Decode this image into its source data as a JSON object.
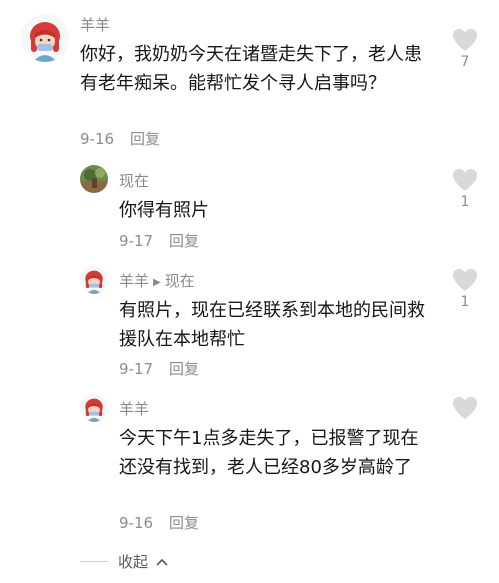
{
  "comments": [
    {
      "username": "羊羊",
      "text": "你好，我奶奶今天在诸暨走失下了，老人患有老年痴呆。能帮忙发个寻人启事吗？",
      "date": "9-16",
      "reply_label": "回复",
      "likes": "7",
      "avatar_icon": "girl-avatar-icon"
    }
  ],
  "replies": [
    {
      "username": "现在",
      "text": "你得有照片",
      "date": "9-17",
      "reply_label": "回复",
      "likes": "1",
      "avatar_icon": "photo-avatar-icon"
    },
    {
      "username": "羊羊",
      "reply_to": "现在",
      "text": "有照片，现在已经联系到本地的民间救援队在本地帮忙",
      "date": "9-17",
      "reply_label": "回复",
      "likes": "1",
      "avatar_icon": "girl-avatar-icon"
    },
    {
      "username": "羊羊",
      "text": "今天下午1点多走失了，已报警了现在还没有找到，老人已经80多岁高龄了",
      "date": "9-16",
      "reply_label": "回复",
      "likes": "",
      "avatar_icon": "girl-avatar-icon"
    }
  ],
  "collapse": {
    "label": "收起",
    "icon": "chevron-up-icon"
  },
  "colors": {
    "text": "#161616",
    "meta": "#8d8d8d",
    "heart": "#d9d9d9",
    "avatar_red": "#d23b37"
  }
}
